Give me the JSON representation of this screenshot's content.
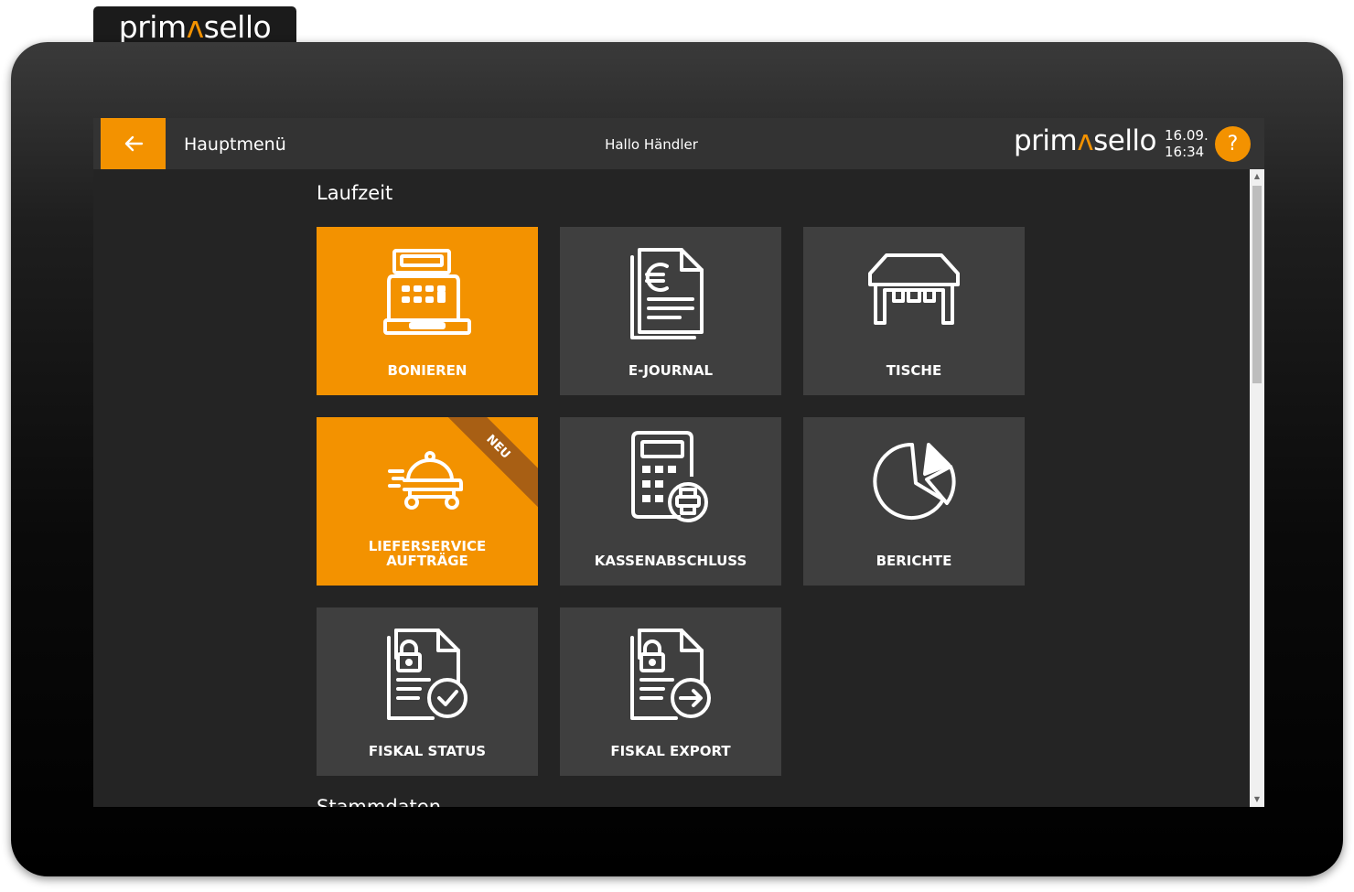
{
  "brand": {
    "prefix": "prim",
    "mark": "ʌ",
    "suffix": "sello"
  },
  "topbar": {
    "back_icon": "arrow-left-icon",
    "title": "Hauptmenü",
    "greeting": "Hallo Händler",
    "date": "16.09.",
    "time": "16:34",
    "help_label": "?"
  },
  "sections": [
    {
      "title": "Laufzeit",
      "tiles": [
        {
          "label": "BONIEREN",
          "icon": "cash-register-icon",
          "highlight": true
        },
        {
          "label": "E-JOURNAL",
          "icon": "euro-document-icon",
          "highlight": false
        },
        {
          "label": "TISCHE",
          "icon": "table-icon",
          "highlight": false
        },
        {
          "label": "LIEFERSERVICE\nAUFTRÄGE",
          "icon": "delivery-cloche-icon",
          "highlight": true,
          "badge": "NEU"
        },
        {
          "label": "KASSENABSCHLUSS",
          "icon": "calculator-printer-icon",
          "highlight": false
        },
        {
          "label": "BERICHTE",
          "icon": "pie-chart-icon",
          "highlight": false
        },
        {
          "label": "FISKAL STATUS",
          "icon": "fiscal-status-icon",
          "highlight": false
        },
        {
          "label": "FISKAL EXPORT",
          "icon": "fiscal-export-icon",
          "highlight": false
        }
      ]
    },
    {
      "title": "Stammdaten"
    }
  ],
  "colors": {
    "accent": "#f39200",
    "tile": "#3f3f3f",
    "background": "#242424",
    "topbar": "#333333"
  }
}
